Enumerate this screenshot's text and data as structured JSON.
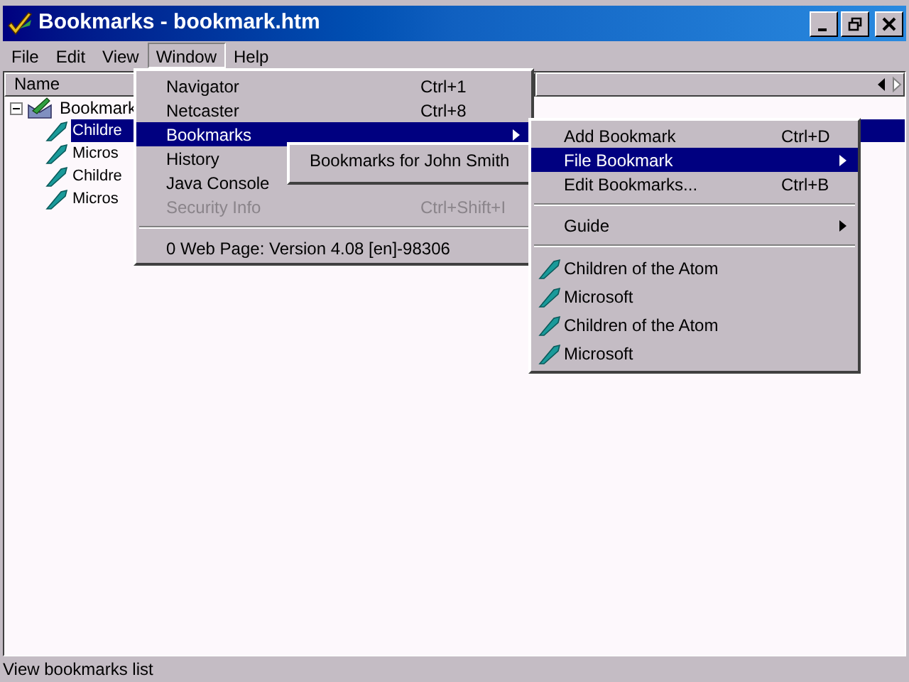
{
  "window": {
    "title": "Bookmarks - bookmark.htm"
  },
  "menubar": [
    {
      "label": "File",
      "selected": false
    },
    {
      "label": "Edit",
      "selected": false
    },
    {
      "label": "View",
      "selected": false
    },
    {
      "label": "Window",
      "selected": true
    },
    {
      "label": "Help",
      "selected": false
    }
  ],
  "tree": {
    "column": "Name",
    "root": {
      "label": "Bookmark",
      "expanded": true,
      "children": [
        {
          "label": "Childre",
          "selected": true
        },
        {
          "label": "Micros",
          "selected": false
        },
        {
          "label": "Childre",
          "selected": false
        },
        {
          "label": "Micros",
          "selected": false
        }
      ]
    }
  },
  "window_menu": [
    {
      "kind": "item",
      "label": "Navigator",
      "shortcut": "Ctrl+1",
      "disabled": false,
      "selected": false,
      "submenu": false
    },
    {
      "kind": "item",
      "label": "Netcaster",
      "shortcut": "Ctrl+8",
      "disabled": false,
      "selected": false,
      "submenu": false
    },
    {
      "kind": "item",
      "label": "Bookmarks",
      "disabled": false,
      "selected": true,
      "submenu": true
    },
    {
      "kind": "item",
      "label": "History",
      "disabled": false,
      "selected": false,
      "submenu": false
    },
    {
      "kind": "item",
      "label": "Java Console",
      "disabled": false,
      "selected": false,
      "submenu": false
    },
    {
      "kind": "item",
      "label": "Security Info",
      "shortcut": "Ctrl+Shift+I",
      "disabled": true,
      "selected": false,
      "submenu": false
    },
    {
      "kind": "separator"
    },
    {
      "kind": "item",
      "label": "0 Web Page: Version 4.08 [en]-98306",
      "disabled": false,
      "selected": false,
      "submenu": false
    }
  ],
  "profile_menu": [
    {
      "label": "Bookmarks for John Smith"
    }
  ],
  "bookmarks_menu": [
    {
      "kind": "item",
      "label": "Add Bookmark",
      "shortcut": "Ctrl+D",
      "selected": false,
      "submenu": false
    },
    {
      "kind": "item",
      "label": "File Bookmark",
      "selected": true,
      "submenu": true
    },
    {
      "kind": "item",
      "label": "Edit Bookmarks...",
      "shortcut": "Ctrl+B",
      "selected": false,
      "submenu": false
    },
    {
      "kind": "separator"
    },
    {
      "kind": "item",
      "label": "Guide",
      "selected": false,
      "submenu": true
    },
    {
      "kind": "separator"
    },
    {
      "kind": "bookmark",
      "label": "Children of the Atom"
    },
    {
      "kind": "bookmark",
      "label": "Microsoft"
    },
    {
      "kind": "bookmark",
      "label": "Children of the Atom"
    },
    {
      "kind": "bookmark",
      "label": "Microsoft"
    }
  ],
  "status_bar": {
    "text": "View bookmarks list"
  }
}
